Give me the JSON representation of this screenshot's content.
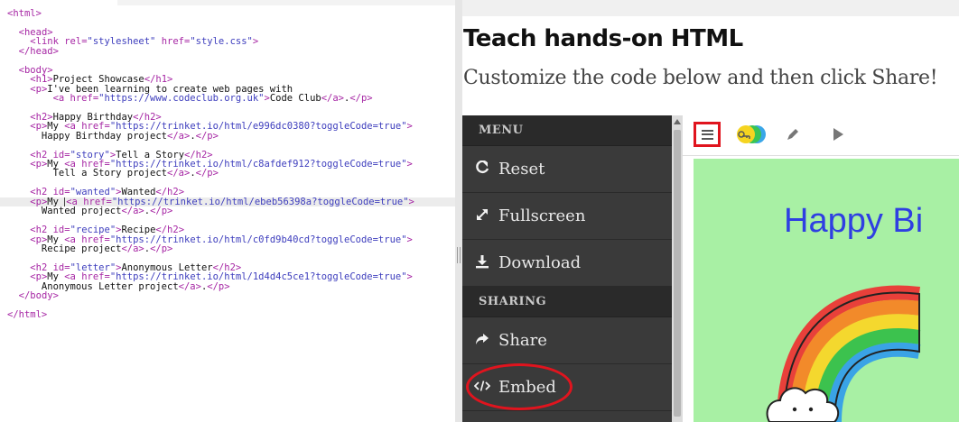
{
  "editor": {
    "lines": [
      {
        "parts": [
          [
            "t",
            "<html>"
          ]
        ]
      },
      {
        "parts": []
      },
      {
        "parts": [
          [
            "tx",
            "  "
          ],
          [
            "t",
            "<head>"
          ]
        ]
      },
      {
        "parts": [
          [
            "tx",
            "    "
          ],
          [
            "t",
            "<link rel="
          ],
          [
            "s",
            "\"stylesheet\""
          ],
          [
            "t",
            " href="
          ],
          [
            "s",
            "\"style.css\""
          ],
          [
            "t",
            ">"
          ]
        ]
      },
      {
        "parts": [
          [
            "tx",
            "  "
          ],
          [
            "t",
            "</head>"
          ]
        ]
      },
      {
        "parts": []
      },
      {
        "parts": [
          [
            "tx",
            "  "
          ],
          [
            "t",
            "<body>"
          ]
        ]
      },
      {
        "parts": [
          [
            "tx",
            "    "
          ],
          [
            "t",
            "<h1>"
          ],
          [
            "tx",
            "Project Showcase"
          ],
          [
            "t",
            "</h1>"
          ]
        ]
      },
      {
        "parts": [
          [
            "tx",
            "    "
          ],
          [
            "t",
            "<p>"
          ],
          [
            "tx",
            "I've been learning to create web pages with"
          ]
        ]
      },
      {
        "parts": [
          [
            "tx",
            "        "
          ],
          [
            "t",
            "<a href="
          ],
          [
            "s",
            "\"https://www.codeclub.org.uk\""
          ],
          [
            "t",
            ">"
          ],
          [
            "tx",
            "Code Club"
          ],
          [
            "t",
            "</a>"
          ],
          [
            "tx",
            "."
          ],
          [
            "t",
            "</p>"
          ]
        ]
      },
      {
        "parts": []
      },
      {
        "parts": [
          [
            "tx",
            "    "
          ],
          [
            "t",
            "<h2>"
          ],
          [
            "tx",
            "Happy Birthday"
          ],
          [
            "t",
            "</h2>"
          ]
        ]
      },
      {
        "parts": [
          [
            "tx",
            "    "
          ],
          [
            "t",
            "<p>"
          ],
          [
            "tx",
            "My "
          ],
          [
            "t",
            "<a href="
          ],
          [
            "s",
            "\"https://trinket.io/html/e996dc0380?toggleCode=true\""
          ],
          [
            "t",
            ">"
          ]
        ]
      },
      {
        "parts": [
          [
            "tx",
            "      Happy Birthday project"
          ],
          [
            "t",
            "</a>"
          ],
          [
            "tx",
            "."
          ],
          [
            "t",
            "</p>"
          ]
        ]
      },
      {
        "parts": []
      },
      {
        "parts": [
          [
            "tx",
            "    "
          ],
          [
            "t",
            "<h2 id="
          ],
          [
            "s",
            "\"story\""
          ],
          [
            "t",
            ">"
          ],
          [
            "tx",
            "Tell a Story"
          ],
          [
            "t",
            "</h2>"
          ]
        ]
      },
      {
        "parts": [
          [
            "tx",
            "    "
          ],
          [
            "t",
            "<p>"
          ],
          [
            "tx",
            "My "
          ],
          [
            "t",
            "<a href="
          ],
          [
            "s",
            "\"https://trinket.io/html/c8afdef912?toggleCode=true\""
          ],
          [
            "t",
            ">"
          ]
        ]
      },
      {
        "parts": [
          [
            "tx",
            "        Tell a Story project"
          ],
          [
            "t",
            "</a>"
          ],
          [
            "tx",
            "."
          ],
          [
            "t",
            "</p>"
          ]
        ]
      },
      {
        "parts": []
      },
      {
        "parts": [
          [
            "tx",
            "    "
          ],
          [
            "t",
            "<h2 id="
          ],
          [
            "s",
            "\"wanted\""
          ],
          [
            "t",
            ">"
          ],
          [
            "tx",
            "Wanted"
          ],
          [
            "t",
            "</h2>"
          ]
        ]
      },
      {
        "parts": [
          [
            "tx",
            "    "
          ],
          [
            "t",
            "<p>"
          ],
          [
            "tx",
            "My "
          ],
          [
            "cur",
            ""
          ],
          [
            "t",
            "<a href="
          ],
          [
            "s",
            "\"https://trinket.io/html/ebeb56398a?toggleCode=true\""
          ],
          [
            "t",
            ">"
          ]
        ],
        "active": true
      },
      {
        "parts": [
          [
            "tx",
            "      Wanted project"
          ],
          [
            "t",
            "</a>"
          ],
          [
            "tx",
            "."
          ],
          [
            "t",
            "</p>"
          ]
        ]
      },
      {
        "parts": []
      },
      {
        "parts": [
          [
            "tx",
            "    "
          ],
          [
            "t",
            "<h2 id="
          ],
          [
            "s",
            "\"recipe\""
          ],
          [
            "t",
            ">"
          ],
          [
            "tx",
            "Recipe"
          ],
          [
            "t",
            "</h2>"
          ]
        ]
      },
      {
        "parts": [
          [
            "tx",
            "    "
          ],
          [
            "t",
            "<p>"
          ],
          [
            "tx",
            "My "
          ],
          [
            "t",
            "<a href="
          ],
          [
            "s",
            "\"https://trinket.io/html/c0fd9b40cd?toggleCode=true\""
          ],
          [
            "t",
            ">"
          ]
        ]
      },
      {
        "parts": [
          [
            "tx",
            "      Recipe project"
          ],
          [
            "t",
            "</a>"
          ],
          [
            "tx",
            "."
          ],
          [
            "t",
            "</p>"
          ]
        ]
      },
      {
        "parts": []
      },
      {
        "parts": [
          [
            "tx",
            "    "
          ],
          [
            "t",
            "<h2 id="
          ],
          [
            "s",
            "\"letter\""
          ],
          [
            "t",
            ">"
          ],
          [
            "tx",
            "Anonymous Letter"
          ],
          [
            "t",
            "</h2>"
          ]
        ]
      },
      {
        "parts": [
          [
            "tx",
            "    "
          ],
          [
            "t",
            "<p>"
          ],
          [
            "tx",
            "My "
          ],
          [
            "t",
            "<a href="
          ],
          [
            "s",
            "\"https://trinket.io/html/1d4d4c5ce1?toggleCode=true\""
          ],
          [
            "t",
            ">"
          ]
        ]
      },
      {
        "parts": [
          [
            "tx",
            "      Anonymous Letter project"
          ],
          [
            "t",
            "</a>"
          ],
          [
            "tx",
            "."
          ],
          [
            "t",
            "</p>"
          ]
        ]
      },
      {
        "parts": [
          [
            "tx",
            "  "
          ],
          [
            "t",
            "</body>"
          ]
        ]
      },
      {
        "parts": []
      },
      {
        "parts": [
          [
            "t",
            "</html>"
          ]
        ]
      }
    ]
  },
  "page": {
    "title": "Teach hands-on HTML",
    "subtitle": "Customize the code below and then click Share!"
  },
  "menu": {
    "menu_heading": "MENU",
    "reset": "Reset",
    "fullscreen": "Fullscreen",
    "download": "Download",
    "sharing_heading": "SHARING",
    "share": "Share",
    "embed": "Embed"
  },
  "trinket": {
    "heading": "Happy Bi"
  },
  "colors": {
    "highlight": "#e0141e",
    "menu_bg": "#3a3a3a",
    "canvas_bg": "#a8f0a4",
    "heading_blue": "#2f3fe2"
  }
}
